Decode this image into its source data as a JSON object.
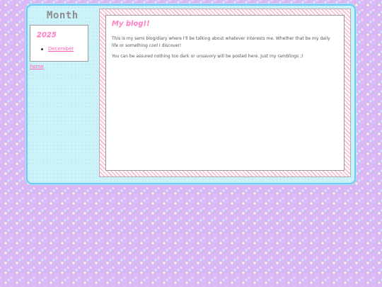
{
  "sidebar": {
    "title": "Month",
    "archive": {
      "year": "2025",
      "months": [
        {
          "label": "December"
        }
      ]
    },
    "home_link": "home"
  },
  "post": {
    "title": "My blog!!",
    "paragraphs": [
      "This is my semi blog/diary where I'll be talking about whatever interests me. Whether that be my daily life or something cool I discover!",
      "You can be assured nothing too dark or unsavory will be posted here. Just my ramblings ;)"
    ]
  },
  "colors": {
    "background": "#d8b8f5",
    "frame": "#cdf3fa",
    "frame_border": "#6ec8f2",
    "accent_pink": "#ff7fc4",
    "link_pink": "#ff5fb7"
  }
}
